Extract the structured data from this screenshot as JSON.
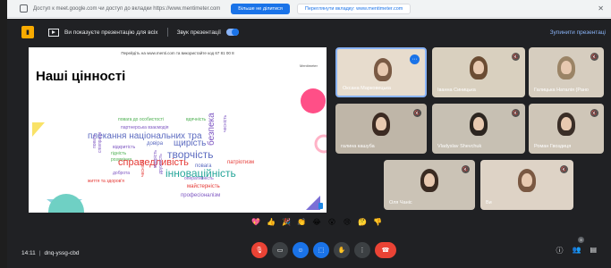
{
  "infobar": {
    "message": "Доступ к meet.google.com чи доступ до вкладки https://www.mentimeter.com",
    "share_button": "Більше не ділитися",
    "switch_button": "Переглянути вкладку: www.mentimeter.com"
  },
  "topbar": {
    "presenting_text": "Ви показуєте презентацію для всіх",
    "sound_label": "Звук презентації",
    "stop_label": "Зупинити презентаці"
  },
  "slide": {
    "header": "Перейдіть на www.menti.com та використайте код 67 81 00 8",
    "brand": "Mentimeter",
    "title": "Наші цінності",
    "words": [
      {
        "text": "повага до особистості",
        "color": "#4caf50"
      },
      {
        "text": "вдячність",
        "color": "#4caf50"
      },
      {
        "text": "партнерська взаємодія",
        "color": "#7e57c2"
      },
      {
        "text": "плекання національних тра",
        "color": "#5c6bc0"
      },
      {
        "text": "довіра",
        "color": "#5c6bc0"
      },
      {
        "text": "щирість",
        "color": "#5c6bc0"
      },
      {
        "text": "чесність",
        "color": "#7e57c2"
      },
      {
        "text": "відкритість",
        "color": "#7e57c2"
      },
      {
        "text": "повага",
        "color": "#7e57c2"
      },
      {
        "text": "гідність",
        "color": "#4caf50"
      },
      {
        "text": "творчість",
        "color": "#5c6bc0"
      },
      {
        "text": "розуміння",
        "color": "#4caf50"
      },
      {
        "text": "справедливість",
        "color": "#e53935"
      },
      {
        "text": "безпека",
        "color": "#7e57c2"
      },
      {
        "text": "патріотизм",
        "color": "#e53935"
      },
      {
        "text": "співпраця",
        "color": "#7e57c2"
      },
      {
        "text": "доброта",
        "color": "#7e57c2"
      },
      {
        "text": "інноваційність",
        "color": "#26a69a"
      },
      {
        "text": "оперативність",
        "color": "#7e57c2"
      },
      {
        "text": "життя та здоров'я",
        "color": "#e53935"
      },
      {
        "text": "чесність",
        "color": "#e53935"
      },
      {
        "text": "майстерність",
        "color": "#e53935"
      },
      {
        "text": "професіоналізм",
        "color": "#7e57c2"
      },
      {
        "text": "дружність",
        "color": "#7e57c2"
      },
      {
        "text": "повага",
        "color": "#5c6bc0"
      },
      {
        "text": "мудрість",
        "color": "#7e57c2"
      }
    ]
  },
  "participants": [
    {
      "name": "Оксана Марковецька"
    },
    {
      "name": "Іванна Синицька"
    },
    {
      "name": "Галицька Наталія (Рано"
    },
    {
      "name": "галина кашуба"
    },
    {
      "name": "Vladyslav Shevchuk"
    },
    {
      "name": "Роман Гвоздиця"
    },
    {
      "name": "Оля Чаніс"
    },
    {
      "name": "Ви"
    }
  ],
  "reactions": [
    "💖",
    "👍",
    "🎉",
    "👏",
    "😂",
    "😮",
    "😢",
    "🤔",
    "👎"
  ],
  "bottombar": {
    "time": "14:11",
    "meeting_code": "dnq-yssg-cbd",
    "people_count": "9"
  },
  "colors": {
    "meet_bg": "#202124",
    "tile_bg": "#3c4043",
    "accent": "#1a73e8",
    "danger": "#ea4335"
  }
}
